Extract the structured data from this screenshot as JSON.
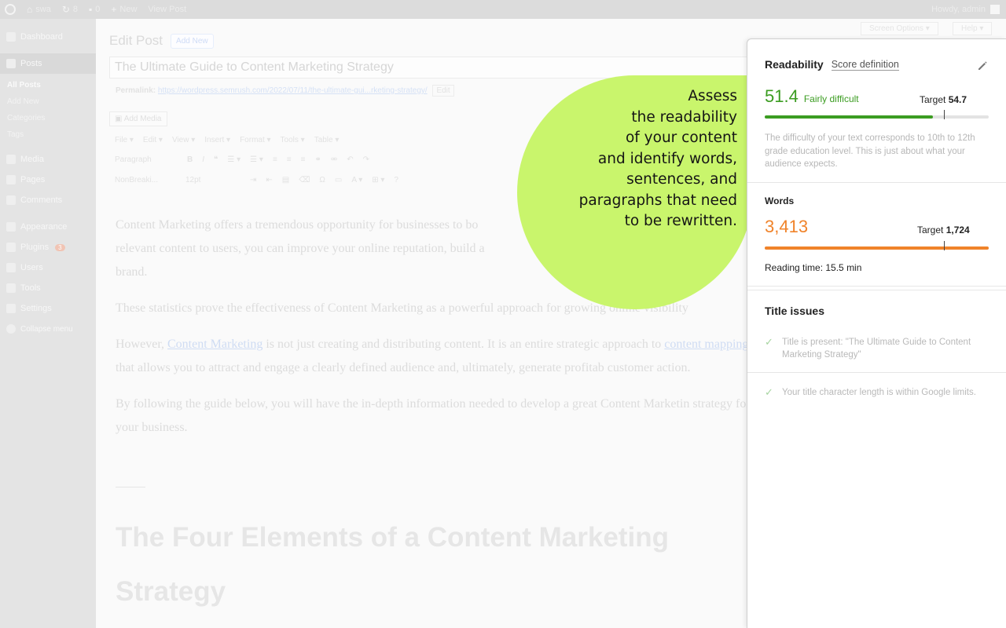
{
  "adminbar": {
    "site_name": "swa",
    "updates_count": "8",
    "comments_count": "0",
    "new_label": "New",
    "view_post_label": "View Post",
    "howdy": "Howdy, admin"
  },
  "sidebar": {
    "dashboard": "Dashboard",
    "posts": "Posts",
    "posts_sub": [
      "All Posts",
      "Add New",
      "Categories",
      "Tags"
    ],
    "media": "Media",
    "pages": "Pages",
    "comments": "Comments",
    "appearance": "Appearance",
    "plugins": "Plugins",
    "plugins_badge": "3",
    "users": "Users",
    "tools": "Tools",
    "settings": "Settings",
    "collapse": "Collapse menu"
  },
  "editor": {
    "heading": "Edit Post",
    "add_new": "Add New",
    "screen_options": "Screen Options ▾",
    "help": "Help ▾",
    "post_title": "The Ultimate Guide to Content Marketing Strategy",
    "permalink_label": "Permalink:",
    "permalink_url": "https://wordpress.semrush.com/2022/07/11/the-ultimate-gui...rketing-strategy/",
    "permalink_edit": "Edit",
    "add_media": "Add Media",
    "menu": [
      "File ▾",
      "Edit ▾",
      "View ▾",
      "Insert ▾",
      "Format ▾",
      "Tools ▾",
      "Table ▾"
    ],
    "paragraph_select": "Paragraph",
    "font_select": "NonBreaki...",
    "size_select": "12pt",
    "p1": "Content Marketing offers a tremendous opportunity for businesses to bo... relevant content to users, you can improve your online reputation, build a ... brand.",
    "p1_a": "Content Marketing offers a tremendous opportunity for businesses to bo",
    "p1_b": "relevant content to users, you can improve your online reputation, build a",
    "p1_c": "brand.",
    "p2": "These statistics prove the effectiveness of Content Marketing as a powerful approach for growing online visibility",
    "p3_pre": "However, ",
    "p3_link1": "Content Marketing",
    "p3_mid": " is not just creating and distributing content. It is an entire strategic approach to ",
    "p3_link2": "content mapping",
    "p3_post": " that allows you to attract and engage a clearly defined audience and, ultimately, generate profitab customer action.",
    "p4": "By following the guide below, you will have the in-depth information needed to develop a great Content Marketin strategy for your business.",
    "h2": "The Four Elements of a Content Marketing Strategy"
  },
  "callout": {
    "lines": [
      "Assess",
      "the readability",
      "of your content",
      "and identify words,",
      "sentences, and",
      "paragraphs that need",
      "to be rewritten."
    ],
    "color": "#c9f56c"
  },
  "panel": {
    "readability_title": "Readability",
    "score_definition": "Score definition",
    "score_value": "51.4",
    "score_label": "Fairly difficult",
    "score_target_label": "Target",
    "score_target_value": "54.7",
    "score_fill_fraction": 0.75,
    "score_target_fraction": 0.8,
    "description": "The difficulty of your text corresponds to 10th to 12th grade education level. This is just about what your audience expects.",
    "words_title": "Words",
    "words_value": "3,413",
    "words_target_label": "Target",
    "words_target_value": "1,724",
    "words_fill_fraction": 1.0,
    "words_target_fraction": 0.8,
    "reading_time": "Reading time: 15.5 min",
    "issues_title": "Title issues",
    "issues": [
      "Title is present: \"The Ultimate Guide to Content Marketing Strategy\"",
      "Your title character length is within Google limits."
    ],
    "colors": {
      "score": "#3b9c21",
      "words": "#f0832a"
    }
  }
}
